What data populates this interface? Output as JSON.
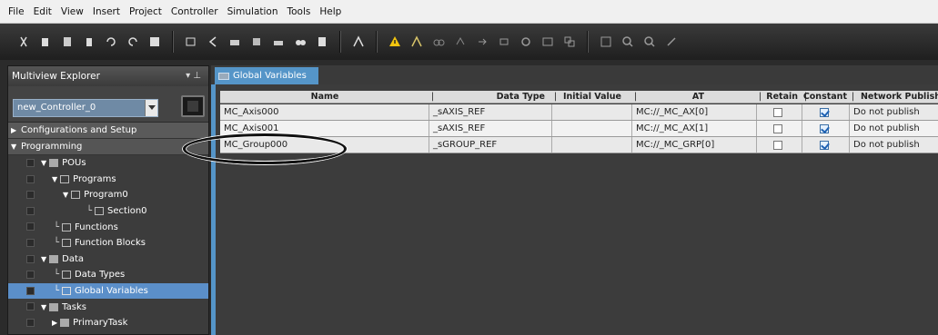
{
  "menu": [
    {
      "label": "File"
    },
    {
      "label": "Edit"
    },
    {
      "label": "View"
    },
    {
      "label": "Insert"
    },
    {
      "label": "Project"
    },
    {
      "label": "Controller"
    },
    {
      "label": "Simulation"
    },
    {
      "label": "Tools"
    },
    {
      "label": "Help"
    }
  ],
  "explorer": {
    "title": "Multiview Explorer",
    "pin": "▾ ⊥",
    "controller": "new_Controller_0",
    "sections": {
      "config": "Configurations and Setup",
      "programming": "Programming"
    },
    "tree": [
      {
        "label": "POUs"
      },
      {
        "label": "Programs"
      },
      {
        "label": "Program0"
      },
      {
        "label": "Section0"
      },
      {
        "label": "Functions"
      },
      {
        "label": "Function Blocks"
      },
      {
        "label": "Data"
      },
      {
        "label": "Data Types"
      },
      {
        "label": "Global Variables"
      },
      {
        "label": "Tasks"
      },
      {
        "label": "PrimaryTask"
      }
    ]
  },
  "editor": {
    "tab_label": "Global Variables",
    "tab_close": "×",
    "columns": [
      "Name",
      "Data Type",
      "Initial Value",
      "AT",
      "Retain",
      "Constant",
      "Network Publish"
    ],
    "rows": [
      {
        "name": "MC_Axis000",
        "data_type": "_sAXIS_REF",
        "initial_value": "",
        "at": "MC://_MC_AX[0]",
        "retain": false,
        "constant": true,
        "network_publish": "Do not publish"
      },
      {
        "name": "MC_Axis001",
        "data_type": "_sAXIS_REF",
        "initial_value": "",
        "at": "MC://_MC_AX[1]",
        "retain": false,
        "constant": true,
        "network_publish": "Do not publish"
      },
      {
        "name": "MC_Group000",
        "data_type": "_sGROUP_REF",
        "initial_value": "",
        "at": "MC://_MC_GRP[0]",
        "retain": false,
        "constant": true,
        "network_publish": "Do not publish"
      }
    ]
  },
  "colors": {
    "selection": "#5b8fc9",
    "editor_frame": "#5595c8",
    "checkbox_check": "#1f62b3"
  }
}
